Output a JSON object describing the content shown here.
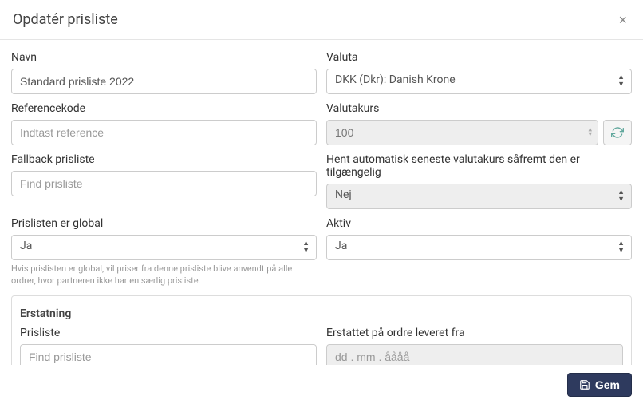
{
  "header": {
    "title": "Opdatér prisliste"
  },
  "form": {
    "name": {
      "label": "Navn",
      "value": "Standard prisliste 2022"
    },
    "currency": {
      "label": "Valuta",
      "value": "DKK (Dkr): Danish Krone"
    },
    "referenceCode": {
      "label": "Referencekode",
      "placeholder": "Indtast reference"
    },
    "exchangeRate": {
      "label": "Valutakurs",
      "value": "100"
    },
    "fallback": {
      "label": "Fallback prisliste",
      "placeholder": "Find prisliste"
    },
    "autoFetch": {
      "label": "Hent automatisk seneste valutakurs såfremt den er tilgængelig",
      "value": "Nej"
    },
    "global": {
      "label": "Prislisten er global",
      "value": "Ja",
      "help": "Hvis prislisten er global, vil priser fra denne prisliste blive anvendt på alle ordrer, hvor partneren ikke har en særlig prisliste."
    },
    "active": {
      "label": "Aktiv",
      "value": "Ja"
    }
  },
  "replacement": {
    "title": "Erstatning",
    "priceList": {
      "label": "Prisliste",
      "placeholder": "Find prisliste"
    },
    "replacedFrom": {
      "label": "Erstattet på ordre leveret fra",
      "placeholder": "dd . mm . åååå"
    }
  },
  "footer": {
    "save": "Gem"
  }
}
